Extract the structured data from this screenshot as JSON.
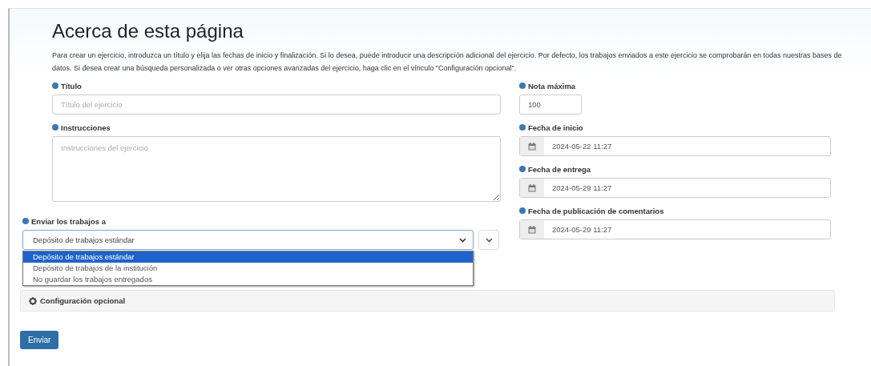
{
  "page": {
    "title": "Acerca de esta página",
    "description": "Para crear un ejercicio, introduzca un título y elija las fechas de inicio y finalización. Si lo desea, puede introducir una descripción adicional del ejercicio. Por defecto, los trabajos enviados a este ejercicio se comprobarán en todas nuestras bases de datos. Si desea crear una búsqueda personalizada o ver otras opciones avanzadas del ejercicio, haga clic en el vínculo \"Configuración opcional\"."
  },
  "title_field": {
    "label": "Título",
    "placeholder": "Título del ejercicio"
  },
  "instructions_field": {
    "label": "Instrucciones",
    "placeholder": "Instrucciones del ejercicio"
  },
  "max_grade_field": {
    "label": "Nota máxima",
    "value": "100"
  },
  "date_fields": [
    {
      "label": "Fecha de inicio",
      "value": "2024-05-22 11:27"
    },
    {
      "label": "Fecha de entrega",
      "value": "2024-05-29 11:27"
    },
    {
      "label": "Fecha de publicación de comentarios",
      "value": "2024-05-29 11:27"
    }
  ],
  "submit_to": {
    "label": "Enviar los trabajos a",
    "value": "Depósito de trabajos estándar",
    "options": [
      {
        "label": "Depósito de trabajos estándar",
        "selected": true
      },
      {
        "label": "Depósito de trabajos de la institución",
        "selected": false
      },
      {
        "label": "No guardar los trabajos entregados",
        "selected": false
      }
    ]
  },
  "optional_settings": {
    "label": "Configuración opcional"
  },
  "submit_button": "Enviar"
}
